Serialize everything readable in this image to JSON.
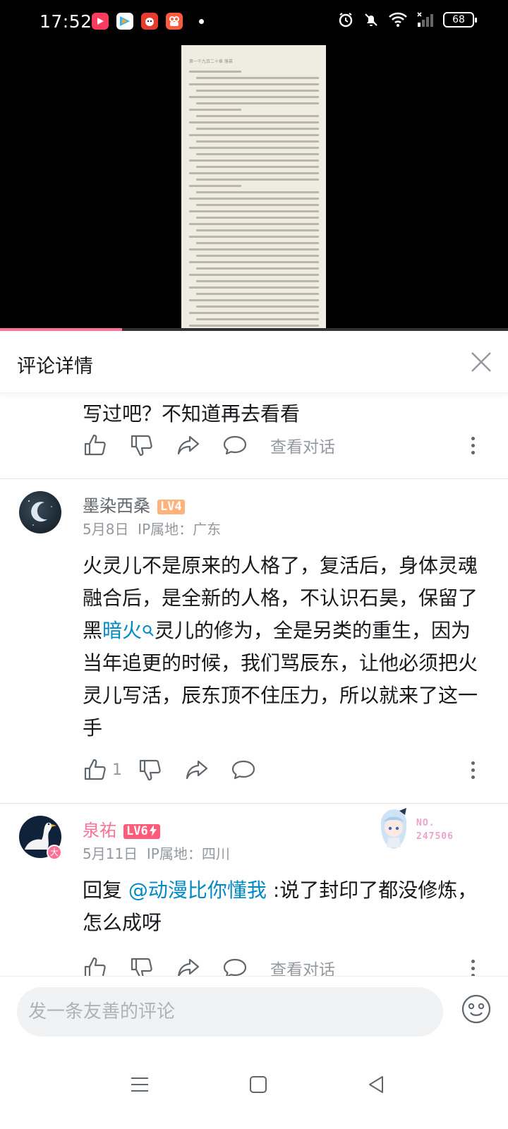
{
  "status_bar": {
    "time": "17:52",
    "battery": "68",
    "app_icons": [
      "video-app-icon",
      "tencent-video-icon",
      "dog-app-icon",
      "camera-app-icon"
    ],
    "sys_icons": [
      "alarm-icon",
      "mute-icon",
      "wifi-icon",
      "signal-icon"
    ]
  },
  "video": {
    "progress_fraction": 0.24,
    "thumb_header": "第一千九百二十章 落幕"
  },
  "panel": {
    "title": "评论详情"
  },
  "comments": [
    {
      "text_tail": "写过吧？不知道再去看看",
      "view_dialog": "查看对话"
    },
    {
      "username": "墨染西桑",
      "level": "LV4",
      "date": "5月8日",
      "ip": "IP属地：广东",
      "text_a": "火灵儿不是原来的人格了，复活后，身体灵魂融合后，是全新的人格，不认识石昊，保留了黑",
      "keyword": "暗火",
      "text_b": "灵儿的修为，全是另类的重生，因为当年追更的时候，我们骂辰东，让他必须把火灵儿写活，辰东顶不住压力，所以就来了这一手",
      "likes": "1"
    },
    {
      "username": "泉祐",
      "level": "LV6",
      "date": "5月11日",
      "ip": "IP属地：四川",
      "badge_no": "NO.",
      "badge_num": "247506",
      "reply_prefix": "回复 ",
      "mention": "@动漫比你懂我",
      "reply_text": " :说了封印了都没修炼，怎么成呀",
      "view_dialog": "查看对话"
    }
  ],
  "input": {
    "placeholder": "发一条友善的评论"
  },
  "colors": {
    "accent_pink": "#fb7299",
    "link_blue": "#008ac5",
    "lv4": "#ffb37c",
    "lv6": "#ff5c7c",
    "vip_name": "#fb7299"
  }
}
